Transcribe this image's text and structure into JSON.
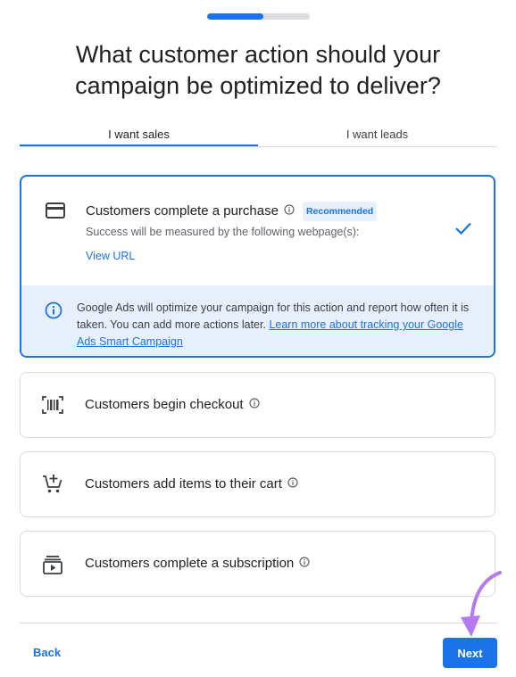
{
  "progress": {
    "fraction": 0.55
  },
  "title": {
    "line1": "What customer action should your",
    "line2": "campaign be optimized to deliver?"
  },
  "tabs": [
    {
      "label": "I want sales",
      "active": true
    },
    {
      "label": "I want leads",
      "active": false
    }
  ],
  "selected_option": {
    "icon": "credit-card-icon",
    "title": "Customers complete a purchase",
    "badge": "Recommended",
    "subtitle": "Success will be measured by the following webpage(s):",
    "link": "View URL",
    "notice": {
      "text": "Google Ads will optimize your campaign for this action and report how often it is taken. You can add more actions later. ",
      "link": "Learn more about tracking your Google Ads Smart Campaign"
    }
  },
  "options": [
    {
      "icon": "barcode-scan-icon",
      "label": "Customers begin checkout"
    },
    {
      "icon": "add-to-cart-icon",
      "label": "Customers add items to their cart"
    },
    {
      "icon": "subscription-icon",
      "label": "Customers complete a subscription"
    }
  ],
  "footer": {
    "back": "Back",
    "next": "Next"
  },
  "colors": {
    "accent": "#1a73e8",
    "notice_bg": "#e8f0fe",
    "arrow": "#b57bee"
  }
}
